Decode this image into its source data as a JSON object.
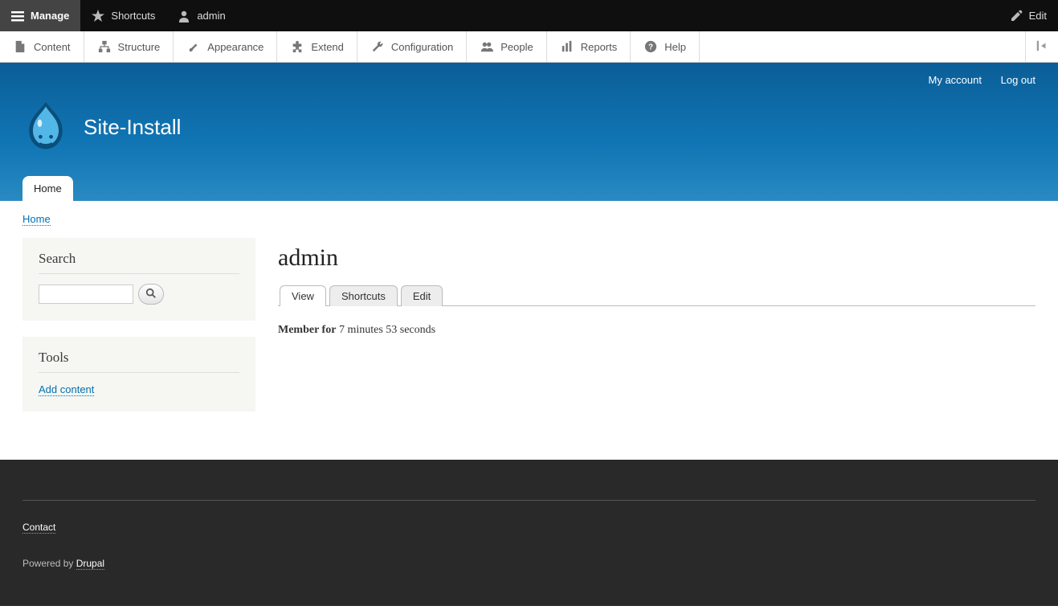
{
  "toolbar": {
    "manage": "Manage",
    "shortcuts": "Shortcuts",
    "user": "admin",
    "edit": "Edit"
  },
  "admin_menu": {
    "content": "Content",
    "structure": "Structure",
    "appearance": "Appearance",
    "extend": "Extend",
    "configuration": "Configuration",
    "people": "People",
    "reports": "Reports",
    "help": "Help"
  },
  "header": {
    "site_name": "Site-Install",
    "user_links": {
      "account": "My account",
      "logout": "Log out"
    },
    "primary_tab": "Home"
  },
  "breadcrumb": {
    "home": "Home"
  },
  "sidebar": {
    "search_title": "Search",
    "tools_title": "Tools",
    "add_content": "Add content"
  },
  "main": {
    "title": "admin",
    "tabs": {
      "view": "View",
      "shortcuts": "Shortcuts",
      "edit": "Edit"
    },
    "member_label": "Member for",
    "member_value": "7 minutes 53 seconds"
  },
  "footer": {
    "contact": "Contact",
    "powered_prefix": "Powered by ",
    "powered_link": "Drupal"
  }
}
